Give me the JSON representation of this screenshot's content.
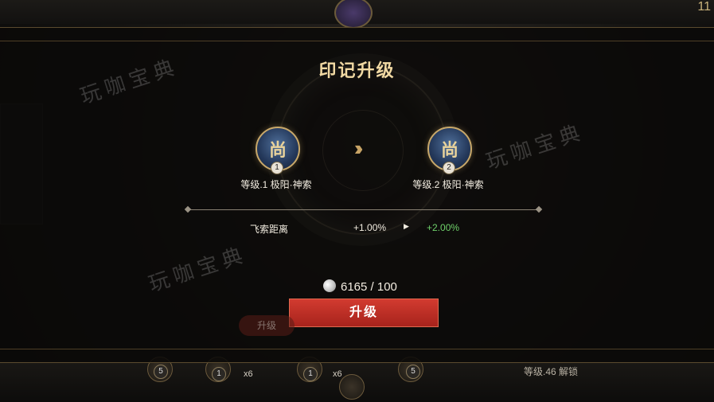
{
  "background": {
    "corner_number": "11",
    "slot_badges": [
      "5",
      "1",
      "1",
      "5"
    ],
    "slot_counts": [
      "x6",
      "x6"
    ],
    "bg_button_label": "升级",
    "unlock_label": "等级.46 解锁"
  },
  "modal": {
    "title": "印记升级",
    "current": {
      "level_badge": "1",
      "caption": "等级.1   极阳·神索",
      "glyph": "尚"
    },
    "next": {
      "level_badge": "2",
      "caption": "等级.2   极阳·神索",
      "glyph": "尚"
    },
    "stat": {
      "name": "飞索距离",
      "from": "+1.00%",
      "to": "+2.00%"
    },
    "cost": "6165 / 100",
    "upgrade_label": "升级"
  },
  "watermarks": [
    "玩咖宝典",
    "玩咖宝典",
    "玩咖宝典"
  ],
  "colors": {
    "accent_gold": "#f1d9a3",
    "button_red": "#c8322a",
    "stat_green": "#6fd06a"
  }
}
